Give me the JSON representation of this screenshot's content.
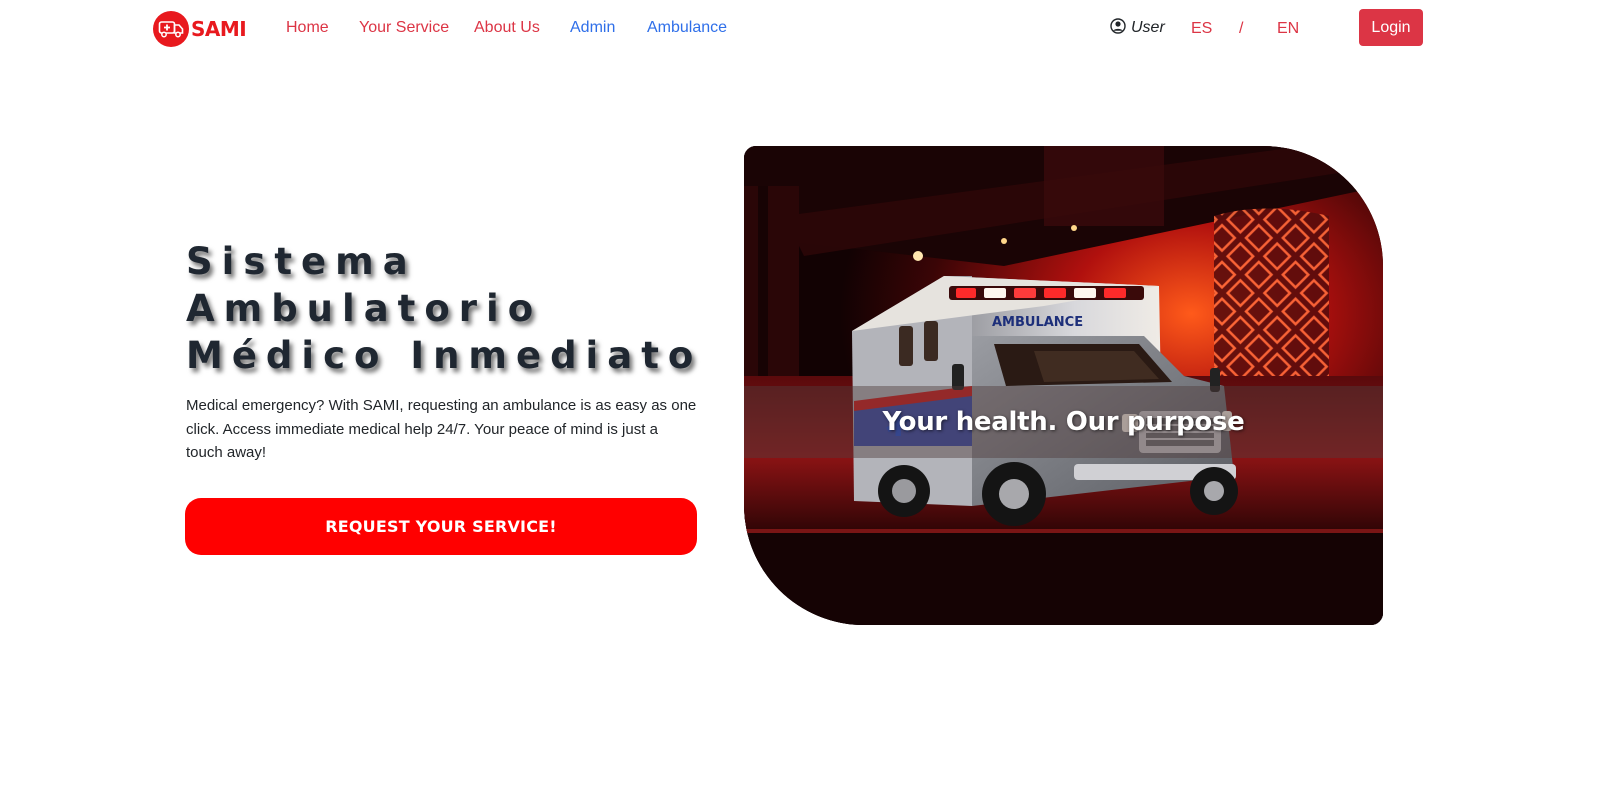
{
  "brand": {
    "name": "SAMI",
    "color": "#e8191e",
    "icon": "ambulance-icon"
  },
  "nav": {
    "home": "Home",
    "your_service": "Your Service",
    "about_us": "About Us",
    "admin": "Admin",
    "ambulance": "Ambulance",
    "user": "User",
    "user_icon": "user-circle-icon",
    "lang_es": "ES",
    "lang_sep": "/",
    "lang_en": "EN",
    "login": "Login"
  },
  "hero": {
    "title_line1": "Sistema",
    "title_line2": "Ambulatorio",
    "title_line3": "Médico Inmediato",
    "description": "Medical emergency? With SAMI, requesting an ambulance is as easy as one click. Access immediate medical help 24/7. Your peace of mind is just a touch away!",
    "cta": "REQUEST YOUR SERVICE!",
    "image_caption": "Your health. Our purpose",
    "vehicle_label": "AMBULANCE"
  },
  "colors": {
    "accent_red": "#dc3545",
    "cta_red": "#ff0000",
    "link_blue": "#2f6fe9"
  }
}
